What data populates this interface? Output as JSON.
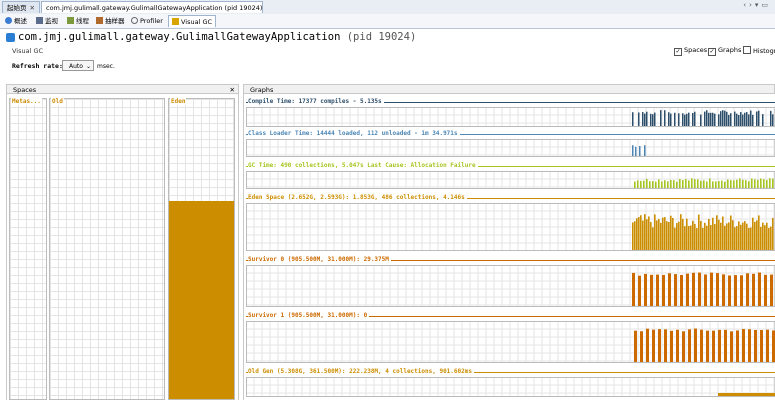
{
  "doc_tabs": [
    {
      "label": "起始页",
      "active": false
    },
    {
      "label": "com.jmj.gulimall.gateway.GulimallGatewayApplication (pid 19024)",
      "active": true
    }
  ],
  "sub_tabs": [
    {
      "label": "概述",
      "icon": "info-icon"
    },
    {
      "label": "监视",
      "icon": "monitor-icon"
    },
    {
      "label": "线程",
      "icon": "threads-icon"
    },
    {
      "label": "抽样器",
      "icon": "sampler-icon"
    },
    {
      "label": "Profiler",
      "icon": "profiler-icon"
    },
    {
      "label": "Visual GC",
      "icon": "visualgc-icon",
      "active": true
    }
  ],
  "header": {
    "title": "com.jmj.gulimall.gateway.GulimallGatewayApplication",
    "pid": "(pid 19024)",
    "section": "Visual GC"
  },
  "checkboxes": [
    {
      "label": "Spaces",
      "checked": true
    },
    {
      "label": "Graphs",
      "checked": true
    },
    {
      "label": "Histogram",
      "checked": false
    }
  ],
  "refresh": {
    "label": "Refresh rate:",
    "value": "Auto",
    "unit": "msec."
  },
  "spaces": {
    "title": "Spaces",
    "columns": [
      {
        "label": "Metas...",
        "fill": 0
      },
      {
        "label": "Old",
        "fill": 0
      },
      {
        "label": "Eden",
        "fill": 0.66
      }
    ]
  },
  "graphs": {
    "title": "Graphs",
    "rows": [
      {
        "label": "Compile Time: 17377 compiles - 5.135s",
        "color": "#2d4f6b"
      },
      {
        "label": "Class Loader Time: 14444 loaded, 112 unloaded - 1m 34.971s",
        "color": "#4b86b4"
      },
      {
        "label": "GC Time: 490 collections, 5.047s  Last Cause: Allocation Failure",
        "color": "#a6c520"
      },
      {
        "label": "Eden Space (2.652G, 2.593G): 1.853G, 486 collections, 4.146s",
        "color": "#cc8e00"
      },
      {
        "label": "Survivor 0 (905.500M, 31.000M): 29.375M",
        "color": "#cc6a00"
      },
      {
        "label": "Survivor 1 (905.500M, 31.000M): 0",
        "color": "#cc6a00"
      },
      {
        "label": "Old Gen (5.308G, 361.500M): 222.238M, 4 collections, 901.602ms",
        "color": "#cc8e00"
      }
    ]
  },
  "colors": {
    "accent_label": "#cc8a00",
    "compile": "#2d4f6b",
    "classloader": "#4b86b4",
    "gc": "#a6c520",
    "eden": "#cc8e00",
    "survivor": "#cc6a00"
  }
}
